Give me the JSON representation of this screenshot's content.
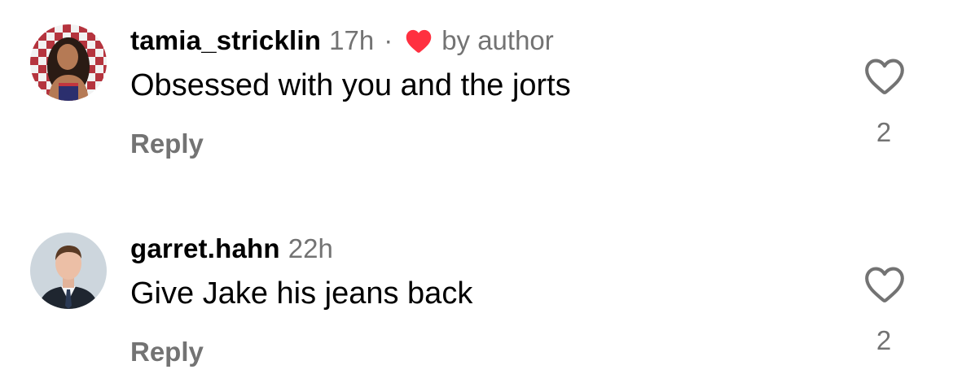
{
  "comments": [
    {
      "username": "tamia_stricklin",
      "time": "17h",
      "separator": "·",
      "author_badge": "by author",
      "text": "Obsessed with you and the jorts",
      "reply_label": "Reply",
      "like_count": "2"
    },
    {
      "username": "garret.hahn",
      "time": "22h",
      "text": "Give Jake his jeans back",
      "reply_label": "Reply",
      "like_count": "2"
    }
  ],
  "colors": {
    "text": "#000000",
    "secondary": "#737373",
    "author_heart": "#ff3040",
    "like_outline": "#737373"
  },
  "icons": {
    "avatar_1": "avatar-checkered-background",
    "avatar_2": "avatar-man-in-suit",
    "author_like": "heart-filled-icon",
    "like_button": "heart-outline-icon"
  }
}
